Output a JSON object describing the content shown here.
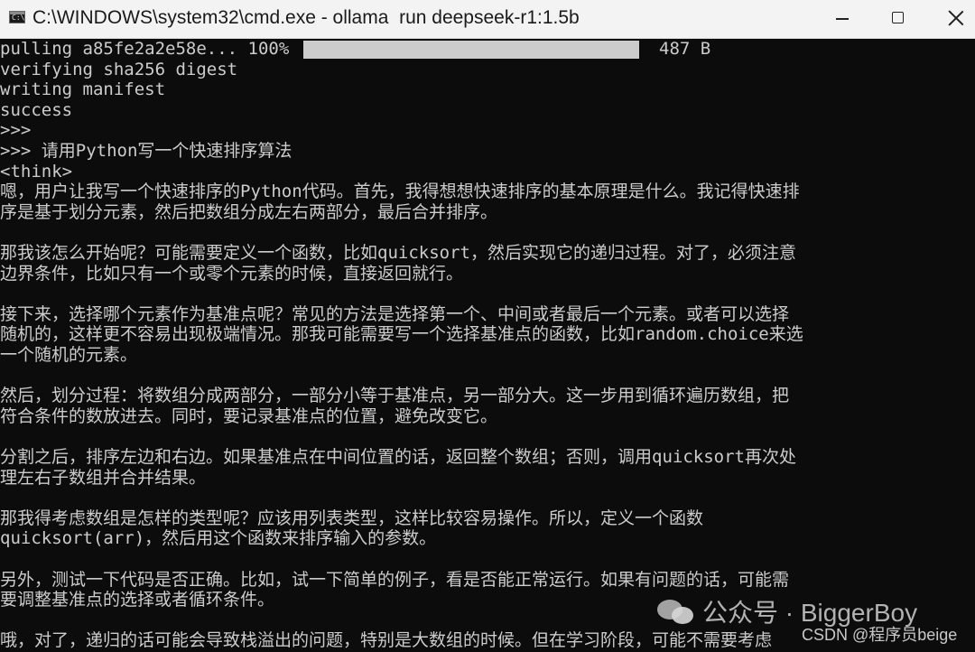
{
  "window": {
    "title": "C:\\WINDOWS\\system32\\cmd.exe - ollama  run deepseek-r1:1.5b",
    "app_icon_glyph": "C:\\",
    "title_bar_color": "#f3f3f3",
    "console_background": "#0c0c0c",
    "console_text_color": "#cccccc"
  },
  "progress": {
    "label": "pulling a85fe2a2e58e... 100%",
    "fraction": 1.0,
    "size": "487 B"
  },
  "console_lines": [
    "verifying sha256 digest",
    "writing manifest",
    "success",
    ">>>",
    ">>> 请用Python写一个快速排序算法",
    "<think>",
    "嗯，用户让我写一个快速排序的Python代码。首先，我得想想快速排序的基本原理是什么。我记得快速排",
    "序是基于划分元素，然后把数组分成左右两部分，最后合并排序。",
    "",
    "那我该怎么开始呢？可能需要定义一个函数，比如quicksort，然后实现它的递归过程。对了，必须注意",
    "边界条件，比如只有一个或零个元素的时候，直接返回就行。",
    "",
    "接下来，选择哪个元素作为基准点呢？常见的方法是选择第一个、中间或者最后一个元素。或者可以选择",
    "随机的，这样更不容易出现极端情况。那我可能需要写一个选择基准点的函数，比如random.choice来选",
    "一个随机的元素。",
    "",
    "然后，划分过程：将数组分成两部分，一部分小等于基准点，另一部分大。这一步用到循环遍历数组，把",
    "符合条件的数放进去。同时，要记录基准点的位置，避免改变它。",
    "",
    "分割之后，排序左边和右边。如果基准点在中间位置的话，返回整个数组；否则，调用quicksort再次处",
    "理左右子数组并合并结果。",
    "",
    "那我得考虑数组是怎样的类型呢？应该用列表类型，这样比较容易操作。所以，定义一个函数",
    "quicksort(arr)，然后用这个函数来排序输入的参数。",
    "",
    "另外，测试一下代码是否正确。比如，试一下简单的例子，看是否能正常运行。如果有问题的话，可能需",
    "要调整基准点的选择或者循环条件。",
    "",
    "哦，对了，递归的话可能会导致栈溢出的问题，特别是大数组的时候。但在学习阶段，可能不需要考虑"
  ],
  "watermark": {
    "icon": "wechat-icon",
    "text": "公众号 · BiggerBoy",
    "csdn": "CSDN @程序员beige"
  }
}
